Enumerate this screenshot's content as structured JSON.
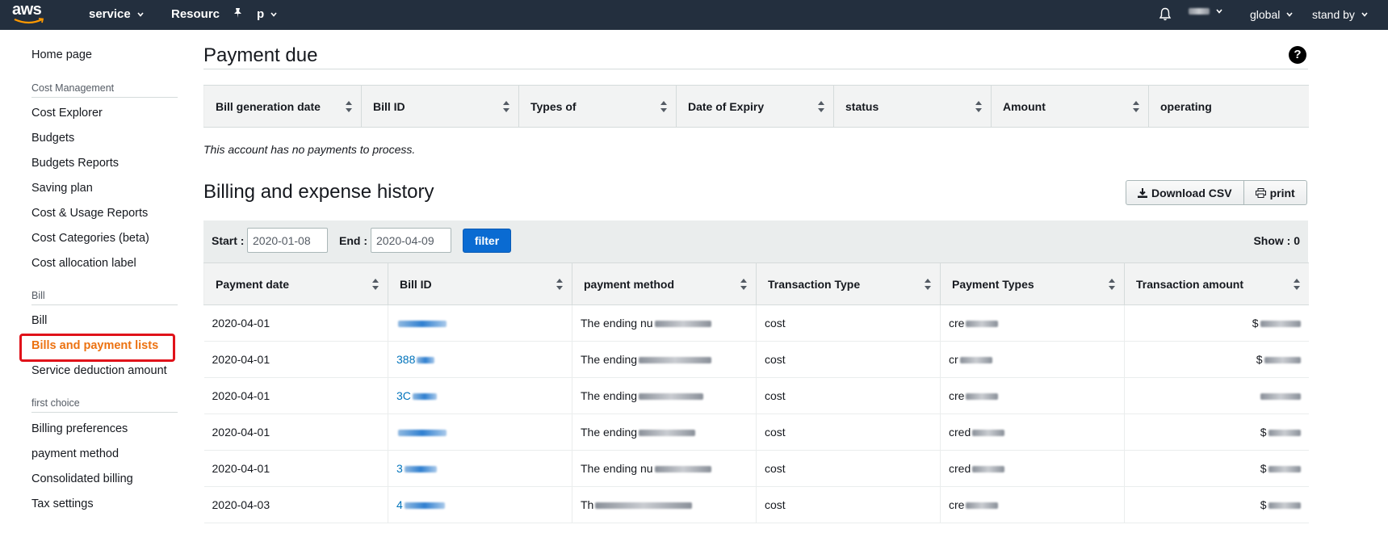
{
  "nav": {
    "logo": "aws",
    "service": "service",
    "resource": "Resourc",
    "pinned": "p",
    "region": "global",
    "support": "stand by"
  },
  "sidebar": {
    "home": "Home page",
    "sections": [
      {
        "title": "Cost Management",
        "items": [
          "Cost Explorer",
          "Budgets",
          "Budgets Reports",
          "Saving plan",
          "Cost & Usage Reports",
          "Cost Categories (beta)",
          "Cost allocation label"
        ]
      },
      {
        "title": "Bill",
        "items": [
          "Bill",
          "Bills and payment lists",
          "Service deduction amount"
        ]
      },
      {
        "title": "first choice",
        "items": [
          "Billing preferences",
          "payment method",
          "Consolidated billing",
          "Tax settings"
        ]
      }
    ],
    "active": "Bills and payment lists"
  },
  "payment_due": {
    "title": "Payment due",
    "columns": [
      "Bill generation date",
      "Bill ID",
      "Types of",
      "Date of Expiry",
      "status",
      "Amount",
      "operating"
    ],
    "empty_message": "This account has no payments to process."
  },
  "history": {
    "title": "Billing and expense history",
    "download_label": "Download CSV",
    "print_label": "print",
    "start_label": "Start :",
    "start_value": "2020-01-08",
    "end_label": "End :",
    "end_value": "2020-04-09",
    "filter_label": "filter",
    "show_label": "Show : 0",
    "columns": [
      "Payment date",
      "Bill ID",
      "payment method",
      "Transaction Type",
      "Payment Types",
      "Transaction amount"
    ],
    "rows": [
      {
        "date": "2020-04-01",
        "bill_id": "",
        "method": "The ending nu",
        "type": "cost",
        "ptype": "cre",
        "amount": "$"
      },
      {
        "date": "2020-04-01",
        "bill_id": "388",
        "method": "The ending",
        "type": "cost",
        "ptype": "cr",
        "amount": "$"
      },
      {
        "date": "2020-04-01",
        "bill_id": "3C",
        "method": "The ending",
        "type": "cost",
        "ptype": "cre",
        "amount": ""
      },
      {
        "date": "2020-04-01",
        "bill_id": "",
        "method": "The ending",
        "type": "cost",
        "ptype": "cred",
        "amount": "$"
      },
      {
        "date": "2020-04-01",
        "bill_id": "3",
        "method": "The ending nu",
        "type": "cost",
        "ptype": "cred",
        "amount": "$"
      },
      {
        "date": "2020-04-03",
        "bill_id": "4",
        "method": "Th",
        "type": "cost",
        "ptype": "cre",
        "amount": "$"
      }
    ]
  }
}
